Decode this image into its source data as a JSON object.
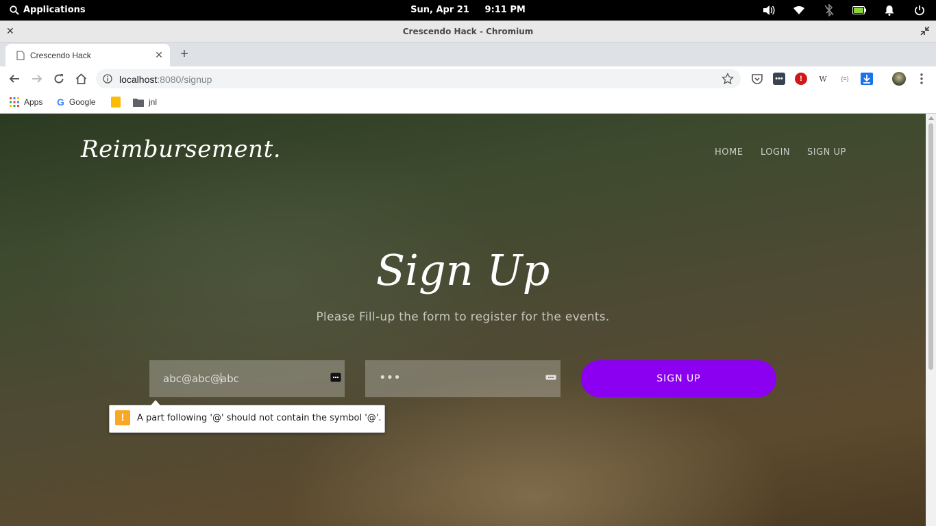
{
  "os_panel": {
    "applications_label": "Applications",
    "datetime": "Sun, Apr 21     9:11 PM"
  },
  "window": {
    "title": "Crescendo Hack - Chromium"
  },
  "tabs": [
    {
      "title": "Crescendo Hack"
    }
  ],
  "address_bar": {
    "host": "localhost",
    "path": ":8080/signup"
  },
  "bookmarks": [
    {
      "label": "Apps"
    },
    {
      "label": "Google"
    },
    {
      "label": ""
    },
    {
      "label": "jnl"
    }
  ],
  "page": {
    "brand": "Reimbursement.",
    "nav": [
      "HOME",
      "LOGIN",
      "SIGN UP"
    ],
    "hero_title": "Sign Up",
    "hero_subtitle": "Please Fill-up the form to register for the events.",
    "email_value_before_caret": "abc@abc@",
    "email_value_after_caret": "abc",
    "password_mask": "•••",
    "signup_button": "SIGN UP",
    "validation_message": "A part following '@' should not contain the symbol '@'.",
    "colors": {
      "signup_button": "#8b00f0",
      "warning": "#f9a825"
    }
  }
}
